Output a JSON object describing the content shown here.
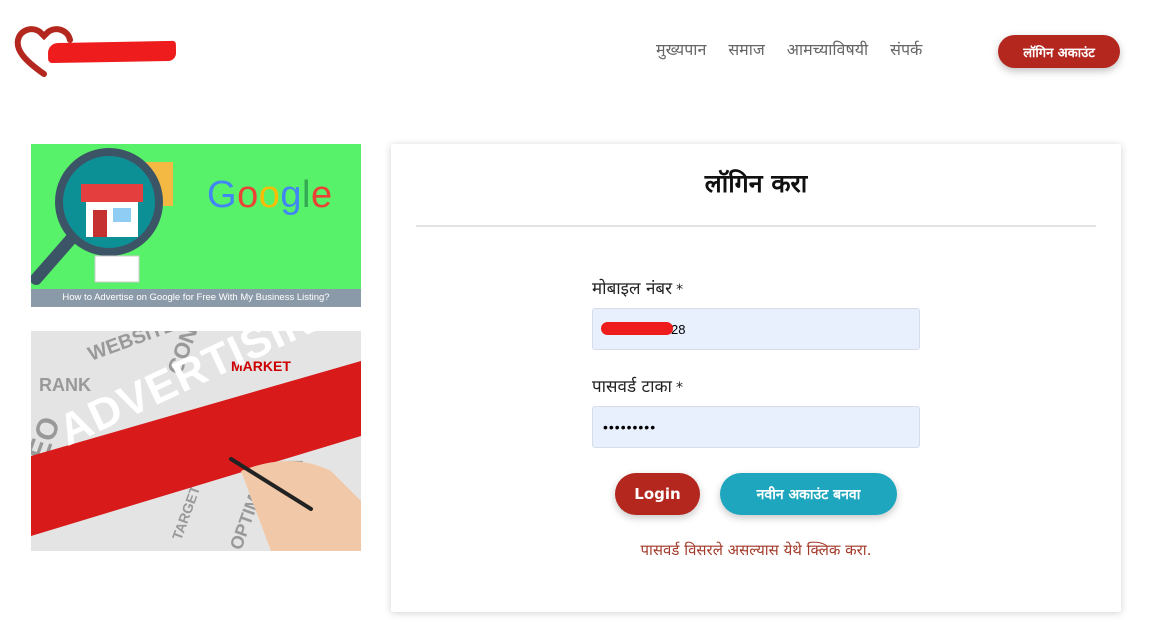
{
  "header": {
    "nav": [
      "मुख्यपान",
      "समाज",
      "आमच्याविषयी",
      "संपर्क"
    ],
    "login_button": "लॉगिन अकाउंट"
  },
  "banners": {
    "google_word": "Google",
    "google_caption": "How to Advertise on Google for Free With My Business Listing?",
    "advertising_word": "ADVERTISING"
  },
  "form": {
    "title": "लॉगिन करा",
    "mobile_label": "मोबाइल नंबर",
    "mobile_value_visible": "28",
    "password_label": "पासवर्ड टाका",
    "password_value": "•••••••••",
    "required_mark": "*",
    "login_button": "Login",
    "new_account_button": "नवीन अकाउंट बनवा",
    "forgot_link": "पासवर्ड विसरले असल्यास येथे क्लिक करा."
  },
  "colors": {
    "brand_red": "#b3271e",
    "teal": "#1da6bd",
    "input_bg": "#e8f0fe"
  }
}
